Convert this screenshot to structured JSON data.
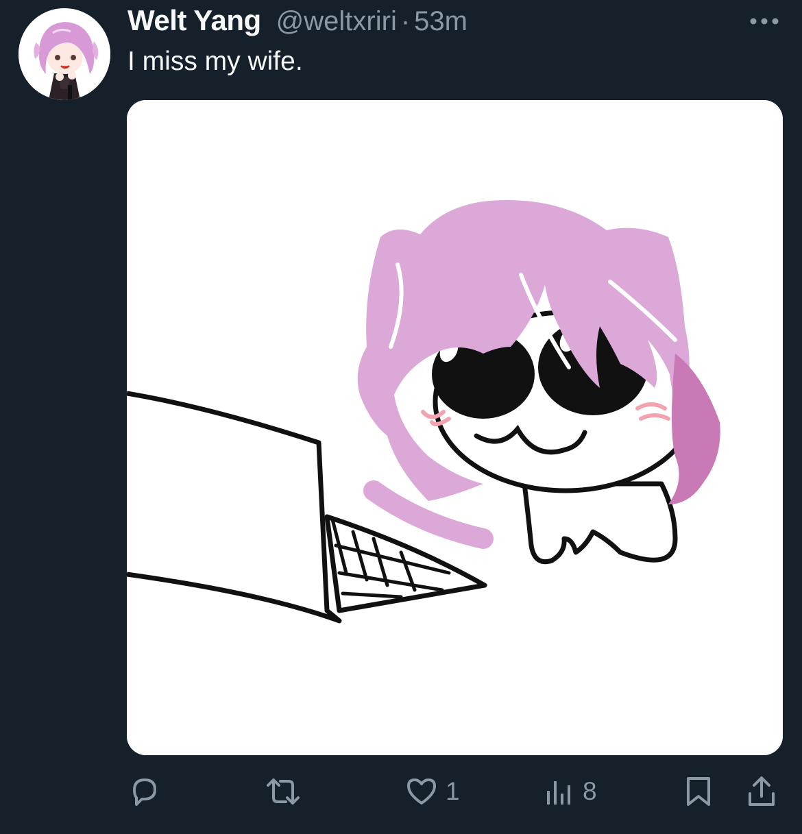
{
  "tweet": {
    "author": {
      "display_name": "Welt Yang",
      "handle": "@weltxriri"
    },
    "separator": "·",
    "time": "53m",
    "text": "I miss my wife.",
    "more_icon": "more-horizontal-icon",
    "media": {
      "kind": "drawing",
      "subject": "pink-haired chibi creature looking at a laptop"
    },
    "actions": {
      "reply": {
        "icon": "reply-icon",
        "count": ""
      },
      "retweet": {
        "icon": "retweet-icon",
        "count": ""
      },
      "like": {
        "icon": "heart-icon",
        "count": "1"
      },
      "views": {
        "icon": "views-chart-icon",
        "count": "8"
      },
      "bookmark": {
        "icon": "bookmark-icon"
      },
      "share": {
        "icon": "share-icon"
      }
    }
  },
  "colors": {
    "background": "#15202b",
    "primary_text": "#f7f9f9",
    "secondary_text": "#8b98a5",
    "hair_pink": "#dca8d8",
    "media_background": "#ffffff"
  }
}
